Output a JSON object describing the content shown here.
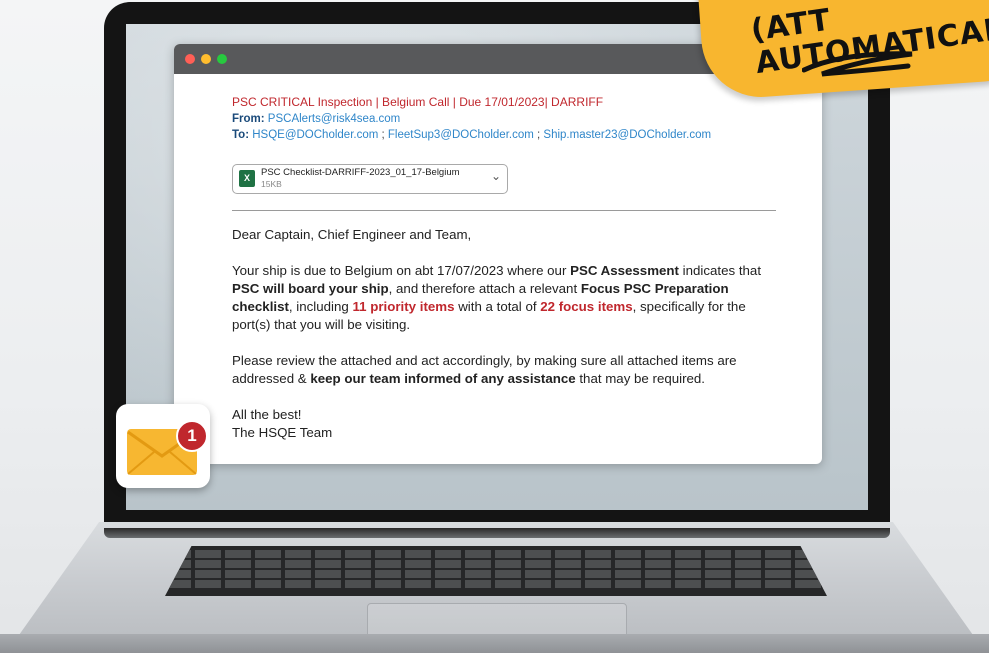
{
  "sticky_note": {
    "line1": "(ATT",
    "line2": "AUTOMATICALLY?"
  },
  "email": {
    "subject": "PSC CRITICAL Inspection | Belgium Call | Due 17/01/2023| DARRIFF",
    "from_label": "From:",
    "from_address": "PSCAlerts@risk4sea.com",
    "to_label": "To:",
    "to_addresses": [
      "HSQE@DOCholder.com",
      "FleetSup3@DOCholder.com",
      "Ship.master23@DOCholder.com"
    ],
    "to_separator": " ; ",
    "attachment": {
      "name": "PSC Checklist-DARRIFF-2023_01_17-Belgium",
      "size": "15KB",
      "icon": "excel-file-icon"
    },
    "greeting": "Dear Captain, Chief Engineer and Team,",
    "p1": {
      "t1": "Your ship is due to Belgium on abt 17/07/2023 where our ",
      "b1": "PSC Assessment",
      "t2": " indicates that ",
      "b2": "PSC will board your ship",
      "t3": ", and therefore attach a relevant ",
      "b3": "Focus PSC Preparation checklist",
      "t4": ", including ",
      "r1": "11 priority items",
      "t5": " with a total of ",
      "r2": "22 focus items",
      "t6": ", specifically for the port(s) that you will be visiting."
    },
    "p2": {
      "t1": "Please review the attached and act accordingly, by making sure all attached items are addressed & ",
      "b1": "keep our team informed of any assistance",
      "t2": " that may be required."
    },
    "signoff": "All the best!",
    "signature": "The HSQE Team"
  },
  "notification": {
    "count": "1",
    "icon": "envelope-icon"
  },
  "colors": {
    "accent_red": "#c0272d",
    "link_blue": "#2f86c9",
    "sticky_yellow": "#f8b62f",
    "envelope_yellow": "#f7b731"
  }
}
